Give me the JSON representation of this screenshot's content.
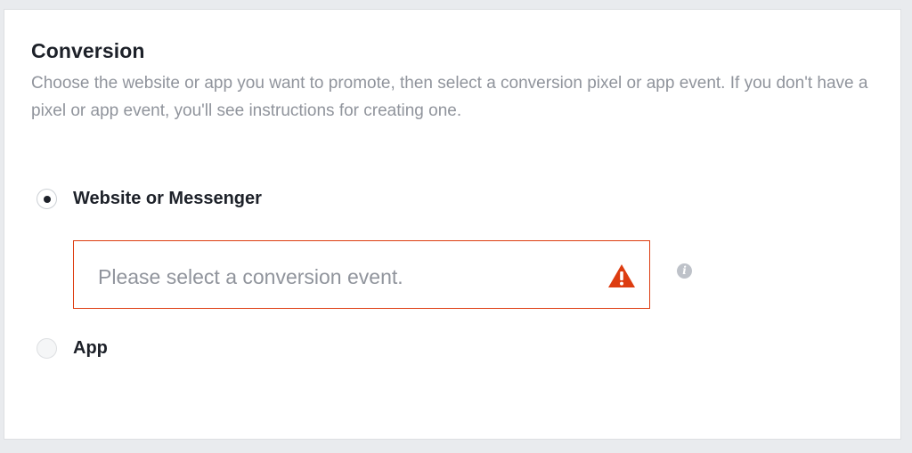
{
  "section": {
    "title": "Conversion",
    "description": "Choose the website or app you want to promote, then select a conversion pixel or app event. If you don't have a pixel or app event, you'll see instructions for creating one."
  },
  "options": {
    "website": {
      "label": "Website or Messenger",
      "selected": true
    },
    "app": {
      "label": "App",
      "selected": false
    }
  },
  "conversion_event_select": {
    "placeholder": "Please select a conversion event.",
    "status": "error",
    "status_icon": "warning-icon",
    "info_icon": "info-icon"
  },
  "colors": {
    "error": "#dd3c10",
    "text_primary": "#1d2129",
    "text_secondary": "#90949c",
    "info_icon": "#bec2c9",
    "page_background": "#e9ebee"
  }
}
